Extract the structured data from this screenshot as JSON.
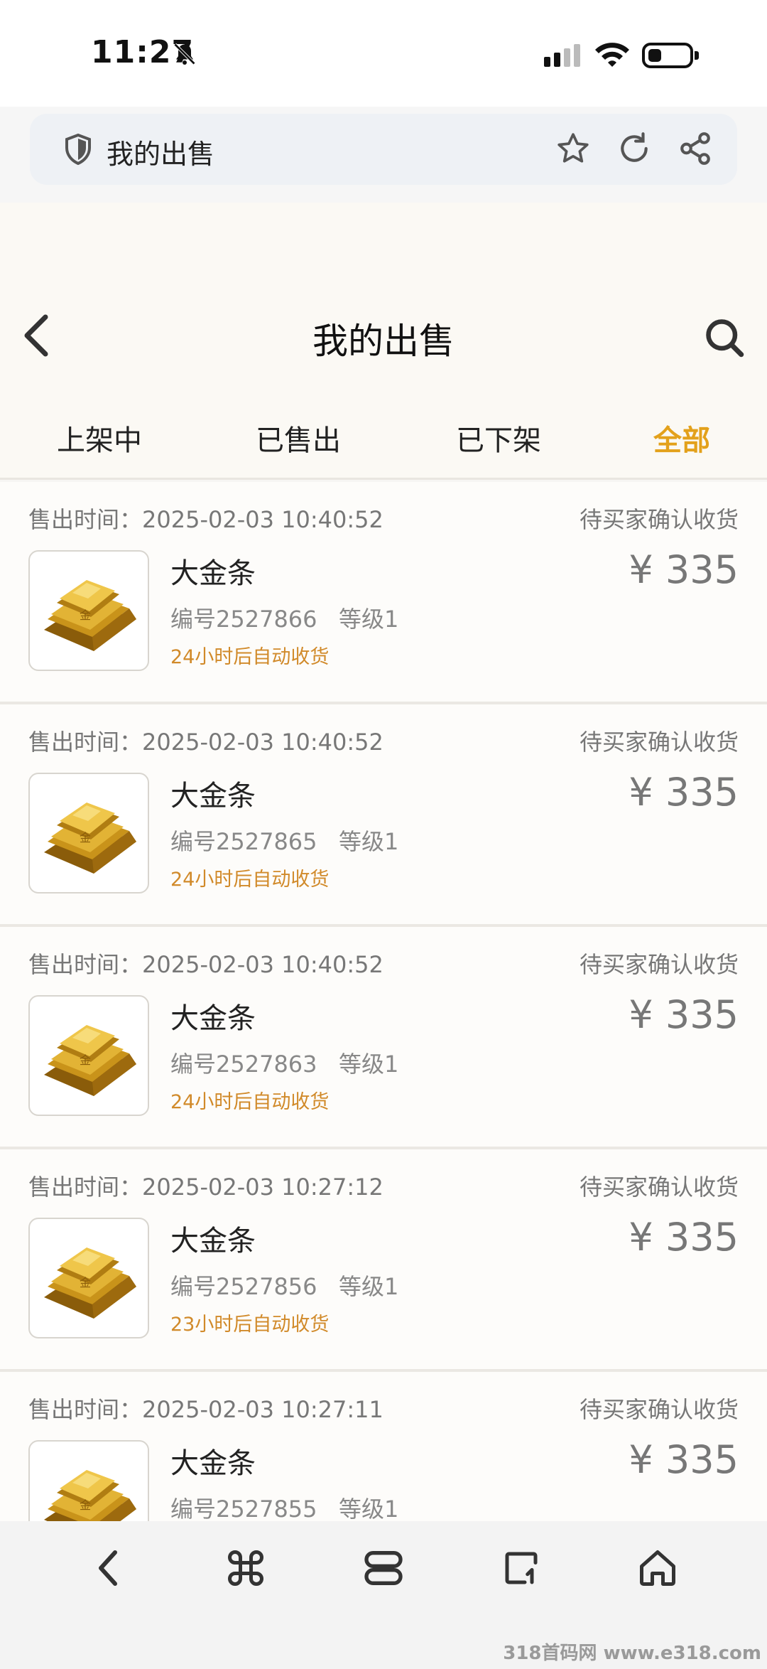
{
  "status_bar": {
    "time": "11:27",
    "icons": [
      "bell-muted-icon",
      "signal-icon",
      "wifi-icon",
      "battery-icon"
    ]
  },
  "browser": {
    "url_title": "我的出售",
    "icons": [
      "shield-icon",
      "star-icon",
      "reload-icon",
      "share-icon"
    ]
  },
  "header": {
    "title": "我的出售",
    "icons": [
      "back-icon",
      "search-icon"
    ]
  },
  "tabs": [
    {
      "label": "上架中",
      "active": false
    },
    {
      "label": "已售出",
      "active": false
    },
    {
      "label": "已下架",
      "active": false
    },
    {
      "label": "全部",
      "active": true
    }
  ],
  "orders": [
    {
      "sold_label": "售出时间：",
      "sold_time": "2025-02-03 10:40:52",
      "status": "待买家确认收货",
      "name": "大金条",
      "serial": "编号2527866",
      "level": "等级1",
      "auto": "24小时后自动收货",
      "price": "¥ 335"
    },
    {
      "sold_label": "售出时间：",
      "sold_time": "2025-02-03 10:40:52",
      "status": "待买家确认收货",
      "name": "大金条",
      "serial": "编号2527865",
      "level": "等级1",
      "auto": "24小时后自动收货",
      "price": "¥ 335"
    },
    {
      "sold_label": "售出时间：",
      "sold_time": "2025-02-03 10:40:52",
      "status": "待买家确认收货",
      "name": "大金条",
      "serial": "编号2527863",
      "level": "等级1",
      "auto": "24小时后自动收货",
      "price": "¥ 335"
    },
    {
      "sold_label": "售出时间：",
      "sold_time": "2025-02-03 10:27:12",
      "status": "待买家确认收货",
      "name": "大金条",
      "serial": "编号2527856",
      "level": "等级1",
      "auto": "23小时后自动收货",
      "price": "¥ 335"
    },
    {
      "sold_label": "售出时间：",
      "sold_time": "2025-02-03 10:27:11",
      "status": "待买家确认收货",
      "name": "大金条",
      "serial": "编号2527855",
      "level": "等级1",
      "auto": "",
      "price": "¥ 335"
    }
  ],
  "bottom_nav": [
    "back-nav-icon",
    "command-icon",
    "tabs-icon",
    "rotate-icon",
    "home-icon"
  ],
  "colors": {
    "accent": "#e3a11b",
    "auto_text": "#d18a2a",
    "gold": "#c9931a"
  },
  "watermark": "318首码网 www.e318.com"
}
